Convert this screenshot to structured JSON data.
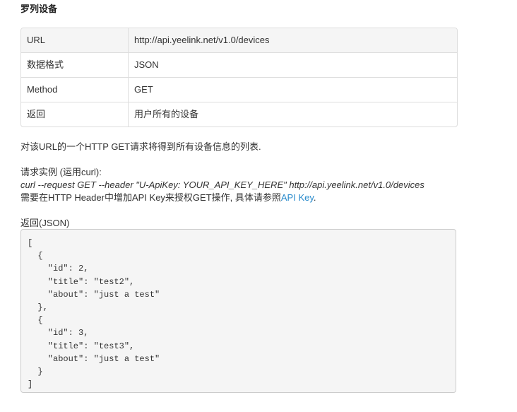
{
  "section": {
    "title": "罗列设备"
  },
  "table": {
    "rows": [
      {
        "key": "URL",
        "value": "http://api.yeelink.net/v1.0/devices"
      },
      {
        "key": "数据格式",
        "value": "JSON"
      },
      {
        "key": "Method",
        "value": "GET"
      },
      {
        "key": "返回",
        "value": "用户所有的设备"
      }
    ]
  },
  "description": "对该URL的一个HTTP GET请求将得到所有设备信息的列表.",
  "example": {
    "label": "请求实例 (运用curl):",
    "command": "curl --request GET --header \"U-ApiKey: YOUR_API_KEY_HERE\" http://api.yeelink.net/v1.0/devices",
    "note_prefix": "需要在HTTP Header中增加API Key来授权GET操作, 具体请参照",
    "note_link": "API Key",
    "note_suffix": "."
  },
  "response": {
    "label": "返回(JSON)",
    "code": "[\n  {\n    \"id\": 2,\n    \"title\": \"test2\",\n    \"about\": \"just a test\"\n  },\n  {\n    \"id\": 3,\n    \"title\": \"test3\",\n    \"about\": \"just a test\"\n  }\n]"
  },
  "colors": {
    "link": "#2a8bcc",
    "code_background": "#f5f5f5",
    "table_header_background": "#f5f5f5",
    "border": "#dddddd"
  }
}
